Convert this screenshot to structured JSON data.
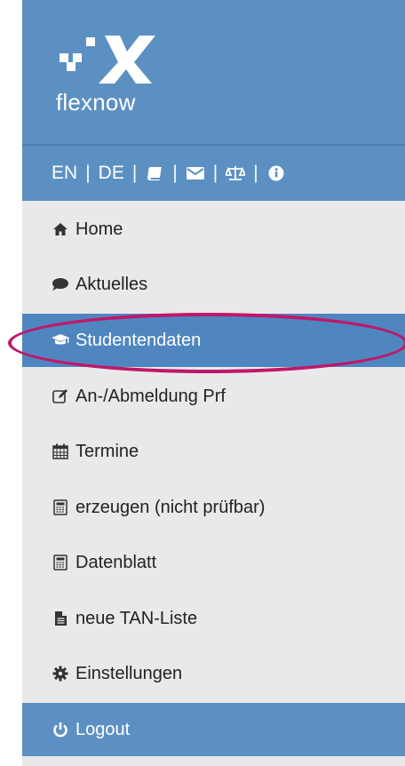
{
  "brand": {
    "logo_text": "flexnow"
  },
  "langbar": {
    "lang_en": "EN",
    "sep": "|",
    "lang_de": "DE",
    "icons": [
      "book-icon",
      "envelope-icon",
      "balance-scale-icon",
      "info-circle-icon"
    ]
  },
  "menu": {
    "items": [
      {
        "label": "Home",
        "icon": "home-icon"
      },
      {
        "label": "Aktuelles",
        "icon": "comment-icon"
      },
      {
        "label": "Studentendaten",
        "icon": "graduation-cap-icon",
        "active": true
      },
      {
        "label": "An-/Abmeldung Prf",
        "icon": "edit-icon"
      },
      {
        "label": "Termine",
        "icon": "calendar-icon"
      },
      {
        "label": "erzeugen (nicht prüfbar)",
        "icon": "calculator-icon"
      },
      {
        "label": "Datenblatt",
        "icon": "calculator-icon"
      },
      {
        "label": "neue TAN-Liste",
        "icon": "file-text-icon"
      },
      {
        "label": "Einstellungen",
        "icon": "gear-icon"
      }
    ],
    "logout": {
      "label": "Logout",
      "icon": "power-icon"
    }
  },
  "colors": {
    "brand_blue": "#5d90c2",
    "active_blue": "#4f86bf",
    "annotation": "#c0176a",
    "menu_bg": "#e9e9e9"
  }
}
